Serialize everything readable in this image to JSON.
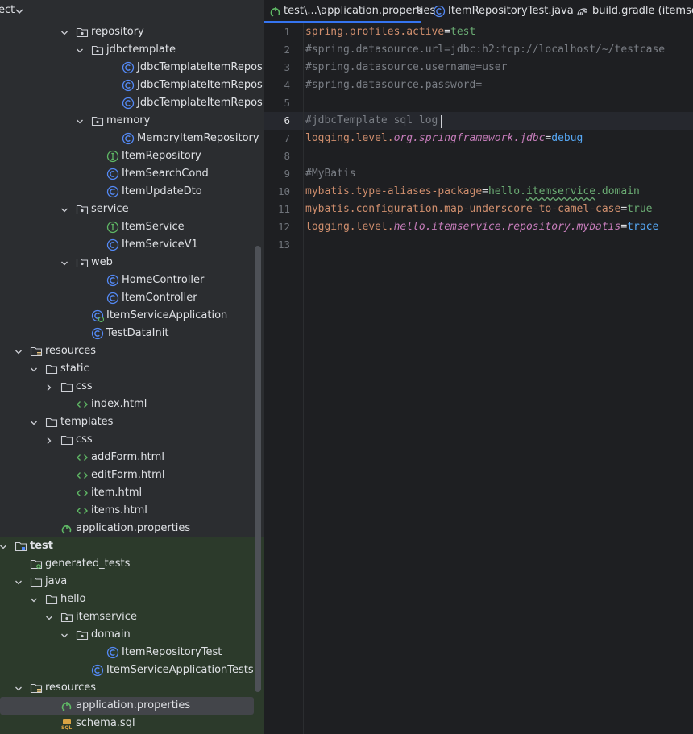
{
  "project_panel": {
    "title": "ect",
    "tree": [
      {
        "label": "repository",
        "type": "package",
        "indent": 5,
        "expanded": true
      },
      {
        "label": "jdbctemplate",
        "type": "package",
        "indent": 6,
        "expanded": true
      },
      {
        "label": "JdbcTemplateItemReposit",
        "type": "class",
        "indent": 8
      },
      {
        "label": "JdbcTemplateItemReposit",
        "type": "class",
        "indent": 8
      },
      {
        "label": "JdbcTemplateItemReposit",
        "type": "class",
        "indent": 8
      },
      {
        "label": "memory",
        "type": "package",
        "indent": 6,
        "expanded": true
      },
      {
        "label": "MemoryItemRepository",
        "type": "class",
        "indent": 8
      },
      {
        "label": "ItemRepository",
        "type": "interface",
        "indent": 7
      },
      {
        "label": "ItemSearchCond",
        "type": "class",
        "indent": 7
      },
      {
        "label": "ItemUpdateDto",
        "type": "class",
        "indent": 7
      },
      {
        "label": "service",
        "type": "package",
        "indent": 5,
        "expanded": true
      },
      {
        "label": "ItemService",
        "type": "interface",
        "indent": 7
      },
      {
        "label": "ItemServiceV1",
        "type": "class",
        "indent": 7
      },
      {
        "label": "web",
        "type": "package",
        "indent": 5,
        "expanded": true
      },
      {
        "label": "HomeController",
        "type": "class",
        "indent": 7
      },
      {
        "label": "ItemController",
        "type": "class",
        "indent": 7
      },
      {
        "label": "ItemServiceApplication",
        "type": "app",
        "indent": 6
      },
      {
        "label": "TestDataInit",
        "type": "class",
        "indent": 6
      },
      {
        "label": "resources",
        "type": "resources",
        "indent": 2,
        "expanded": true
      },
      {
        "label": "static",
        "type": "folder",
        "indent": 3,
        "expanded": true
      },
      {
        "label": "css",
        "type": "folder",
        "indent": 4,
        "expanded": false
      },
      {
        "label": "index.html",
        "type": "html",
        "indent": 5
      },
      {
        "label": "templates",
        "type": "folder",
        "indent": 3,
        "expanded": true
      },
      {
        "label": "css",
        "type": "folder",
        "indent": 4,
        "expanded": false
      },
      {
        "label": "addForm.html",
        "type": "html",
        "indent": 5
      },
      {
        "label": "editForm.html",
        "type": "html",
        "indent": 5
      },
      {
        "label": "item.html",
        "type": "html",
        "indent": 5
      },
      {
        "label": "items.html",
        "type": "html",
        "indent": 5
      },
      {
        "label": "application.properties",
        "type": "properties",
        "indent": 4
      },
      {
        "label": "test",
        "type": "module",
        "indent": 1,
        "expanded": true,
        "bold": true
      },
      {
        "label": "generated_tests",
        "type": "gen",
        "indent": 2
      },
      {
        "label": "java",
        "type": "folder",
        "indent": 2,
        "expanded": true
      },
      {
        "label": "hello",
        "type": "folder",
        "indent": 3,
        "expanded": true
      },
      {
        "label": "itemservice",
        "type": "package",
        "indent": 4,
        "expanded": true
      },
      {
        "label": "domain",
        "type": "package",
        "indent": 5,
        "expanded": true
      },
      {
        "label": "ItemRepositoryTest",
        "type": "class",
        "indent": 7
      },
      {
        "label": "ItemServiceApplicationTests",
        "type": "class",
        "indent": 6
      },
      {
        "label": "resources",
        "type": "resources",
        "indent": 2,
        "expanded": true
      },
      {
        "label": "application.properties",
        "type": "properties",
        "indent": 4,
        "selected": true
      },
      {
        "label": "schema.sql",
        "type": "sql",
        "indent": 4
      }
    ]
  },
  "editor": {
    "tabs": [
      {
        "label": "test\\...\\application.properties",
        "icon": "properties-icon",
        "active": true,
        "closable": true
      },
      {
        "label": "ItemRepositoryTest.java",
        "icon": "class-icon"
      },
      {
        "label": "build.gradle (itemserv",
        "icon": "gradle-icon"
      }
    ],
    "current_line": 6,
    "lines": [
      [
        {
          "t": "spring.profiles.active",
          "c": "k"
        },
        {
          "t": "=",
          "c": "eq"
        },
        {
          "t": "test",
          "c": "v"
        }
      ],
      [
        {
          "t": "#spring.datasource.url=jdbc:h2:tcp://localhost/~/testcase",
          "c": "c"
        }
      ],
      [
        {
          "t": "#spring.datasource.username=user",
          "c": "c"
        }
      ],
      [
        {
          "t": "#spring.datasource.password=",
          "c": "c"
        }
      ],
      [],
      [
        {
          "t": "#jdbcTemplate sql log",
          "c": "c"
        }
      ],
      [
        {
          "t": "logging.level.",
          "c": "k"
        },
        {
          "t": "org.springframework.jdbc",
          "c": "ki"
        },
        {
          "t": "=",
          "c": "eq"
        },
        {
          "t": "debug",
          "c": "kw"
        }
      ],
      [],
      [
        {
          "t": "#MyBatis",
          "c": "c"
        }
      ],
      [
        {
          "t": "mybatis.type-aliases-package",
          "c": "k"
        },
        {
          "t": "=",
          "c": "eq"
        },
        {
          "t": "hello.",
          "c": "v"
        },
        {
          "t": "itemservice",
          "c": "v sq"
        },
        {
          "t": ".domain",
          "c": "v"
        }
      ],
      [
        {
          "t": "mybatis.configuration.map-underscore-to-camel-case",
          "c": "k"
        },
        {
          "t": "=",
          "c": "eq"
        },
        {
          "t": "true",
          "c": "v"
        }
      ],
      [
        {
          "t": "logging.level.",
          "c": "k"
        },
        {
          "t": "hello.itemservice.repository.mybatis",
          "c": "ki"
        },
        {
          "t": "=",
          "c": "eq"
        },
        {
          "t": "trace",
          "c": "kw"
        }
      ],
      []
    ]
  },
  "colors": {
    "accent": "#3574f0",
    "class_icon": "#548af7",
    "interface_icon": "#5fb865",
    "spring_icon": "#5fb865",
    "folder_icon": "#ced0d6"
  }
}
